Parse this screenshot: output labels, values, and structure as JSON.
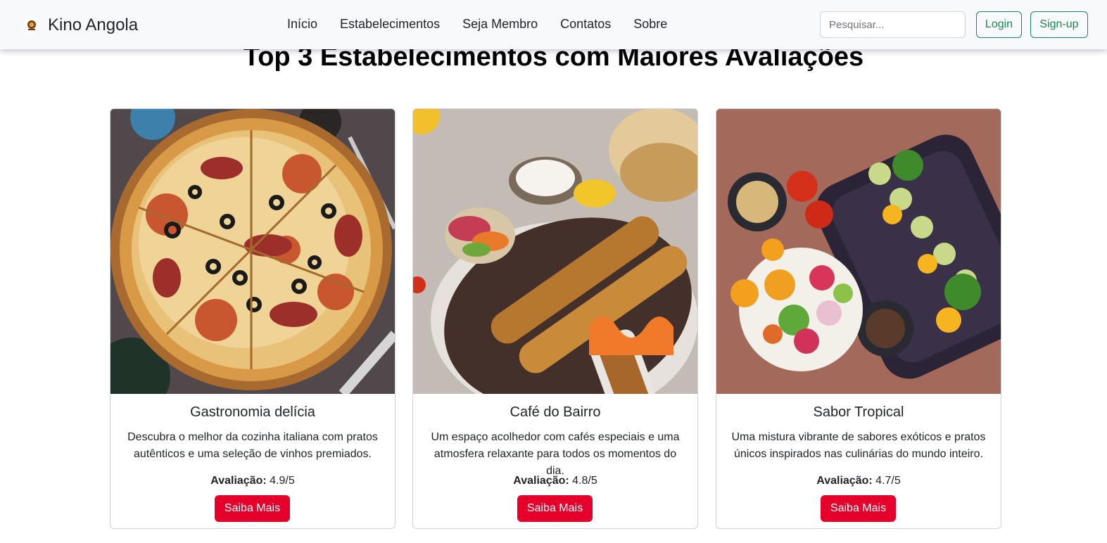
{
  "navbar": {
    "brand": "Kino Angola",
    "links": [
      "Início",
      "Estabelecimentos",
      "Seja Membro",
      "Contatos",
      "Sobre"
    ],
    "search_placeholder": "Pesquisar...",
    "login": "Login",
    "signup": "Sign-up",
    "accent": "#198754"
  },
  "section": {
    "title": "Top 3 Estabelecimentos com Maiores Avaliações"
  },
  "cards": [
    {
      "title": "Gastronomia delícia",
      "text": "Descubra o melhor da cozinha italiana com pratos autênticos e uma seleção de vinhos premiados.",
      "rating_label": "Avaliação:",
      "rating_value": "4.9/5",
      "button": "Saiba Mais",
      "image": "pizza-photo"
    },
    {
      "title": "Café do Bairro",
      "text": "Um espaço acolhedor com cafés especiais e uma atmosfera relaxante para todos os momentos do dia.",
      "rating_label": "Avaliação:",
      "rating_value": "4.8/5",
      "button": "Saiba Mais",
      "image": "kebab-platter-photo"
    },
    {
      "title": "Sabor Tropical",
      "text": "Uma mistura vibrante de sabores exóticos e pratos únicos inspirados nas culinárias do mundo inteiro.",
      "rating_label": "Avaliação:",
      "rating_value": "4.7/5",
      "button": "Saiba Mais",
      "image": "tropical-salad-photo"
    }
  ],
  "colors": {
    "button_red": "#e4002b",
    "navbar_bg": "#f8f9fa"
  }
}
